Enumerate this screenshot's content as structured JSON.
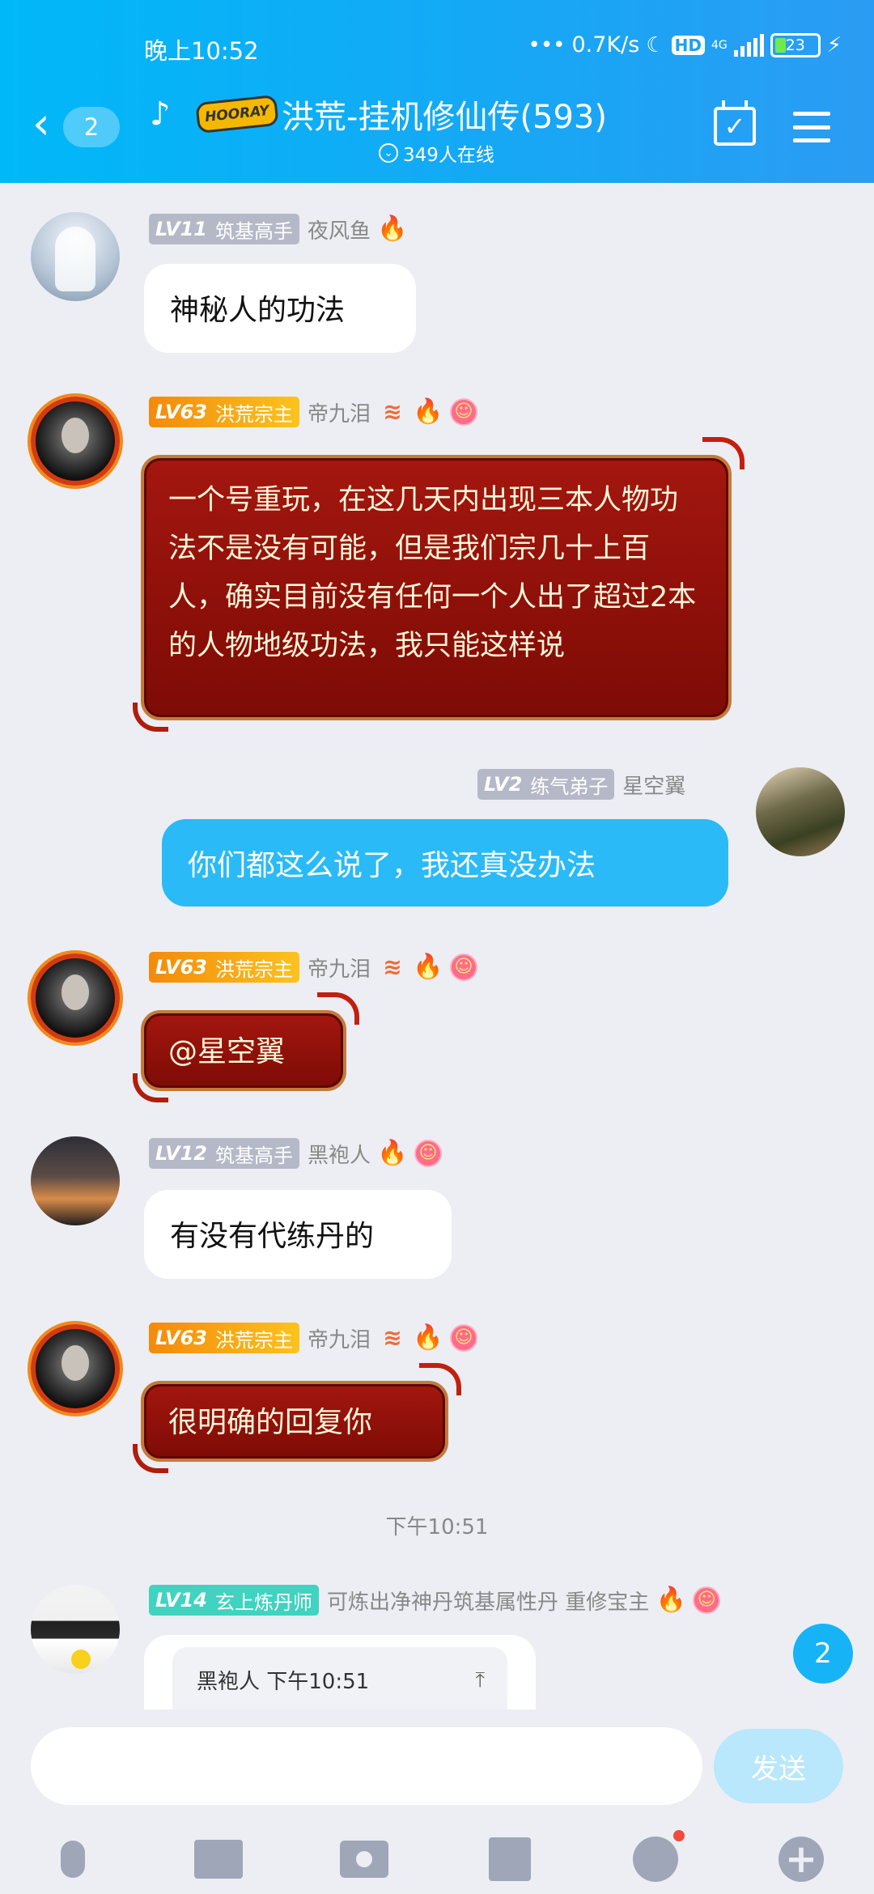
{
  "status_bar": {
    "time": "晚上10:52",
    "network_speed": "0.7K/s",
    "hd": "HD",
    "network_type": "4G",
    "battery": "23"
  },
  "header": {
    "back_count": "2",
    "logo_text": "HOORAY",
    "group_title": "洪荒-挂机修仙传(593)",
    "online_count": "349人在线"
  },
  "messages": [
    {
      "level": "LV11",
      "title": "筑基高手",
      "nick": "夜风鱼",
      "text": "神秘人的功法"
    },
    {
      "level": "LV63",
      "title": "洪荒宗主",
      "nick": "帝九泪",
      "text": "一个号重玩，在这几天内出现三本人物功法不是没有可能，但是我们宗几十上百人，确实目前没有任何一个人出了超过2本的人物地级功法，我只能这样说"
    },
    {
      "level": "LV2",
      "title": "练气弟子",
      "nick": "星空翼",
      "text": "你们都这么说了，我还真没办法"
    },
    {
      "level": "LV63",
      "title": "洪荒宗主",
      "nick": "帝九泪",
      "text": "@星空翼"
    },
    {
      "level": "LV12",
      "title": "筑基高手",
      "nick": "黑袍人",
      "text": "有没有代练丹的"
    },
    {
      "level": "LV63",
      "title": "洪荒宗主",
      "nick": "帝九泪",
      "text": "很明确的回复你"
    },
    {
      "level": "LV14",
      "title": "玄上炼丹师",
      "nick": "可炼出净神丹筑基属性丹 重修宝主",
      "reply_preview": "黑袍人 下午10:51"
    }
  ],
  "time_separator": "下午10:51",
  "new_message_count": "2",
  "input": {
    "placeholder": "",
    "send_label": "发送"
  },
  "toolbar_icons": [
    "mic-icon",
    "image-icon",
    "camera-icon",
    "red-packet-icon",
    "emoji-icon",
    "plus-icon"
  ]
}
